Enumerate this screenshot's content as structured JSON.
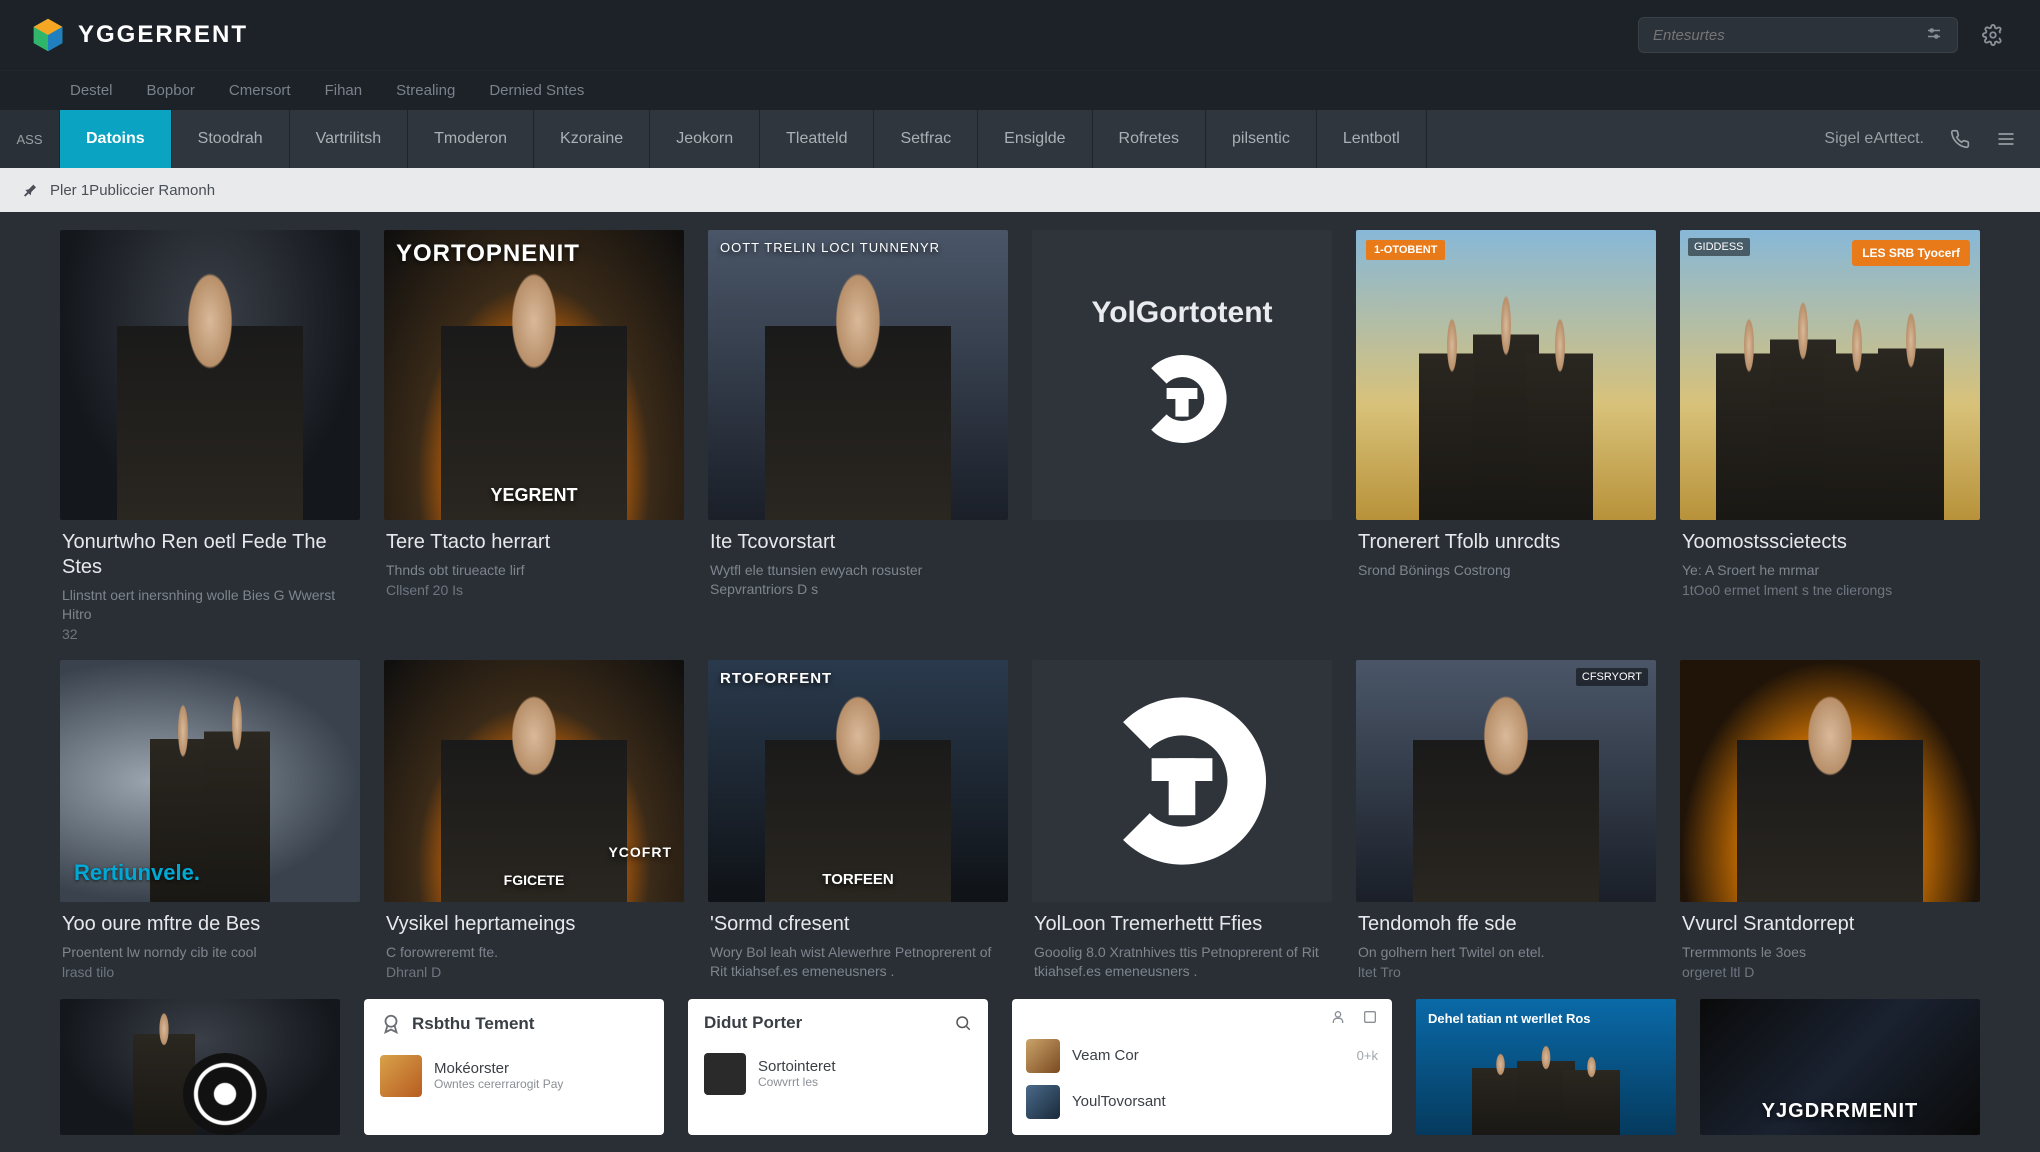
{
  "header": {
    "site_name": "YGGERRENT",
    "search_placeholder": "Entesurtes"
  },
  "subnav": [
    "Destel",
    "Bopbor",
    "Cmersort",
    "Fihan",
    "Strealing",
    "Dernied Sntes"
  ],
  "tabs": {
    "first": "ASS",
    "items": [
      "Datoins",
      "Stoodrah",
      "Vartrilitsh",
      "Tmoderon",
      "Kzoraine",
      "Jeokorn",
      "Tleatteld",
      "Setfrac",
      "Ensiglde",
      "Rofretes",
      "pilsentic",
      "Lentbotl"
    ],
    "active_index": 0,
    "right_label": "Sigel eArttect."
  },
  "breadcrumb": "Pler 1Publiccier Ramonh",
  "row1": [
    {
      "overlay": "",
      "title": "Yonurtwho Ren oetl Fede The Stes",
      "desc": "Llinstnt oert inersnhing wolle\nBies G Wwerst Hitro",
      "meta": "32",
      "poster_cls": "grad-dark",
      "person": true
    },
    {
      "overlay": "YORTOPNENIT",
      "brand_bottom": "YEGRENT",
      "title": "Tere Ttacto herrart",
      "desc": "Thnds obt tirueacte lirf",
      "meta": "Cllsenf  20 Is",
      "poster_cls": "grad-fire",
      "person": true
    },
    {
      "overlay": "OOTT TRELIN LOCI TUNNENYR",
      "title": "Ite Tcovorstart",
      "desc": "Wytfl ele ttunsien ewyach\nrosuster Sepvrantriors D s",
      "poster_cls": "grad-city",
      "person": true
    },
    {
      "hero": true,
      "hero_title": "YolGortotent"
    },
    {
      "orange_top_left": "1-OTOBENT",
      "title": "Tronerert Tfolb unrcdts",
      "desc": "Srond Bönings\nCostrong",
      "poster_cls": "grad-desert",
      "group": true
    },
    {
      "orange_badge": "LES SRB\nTyocerf",
      "corner": "GIDDESS",
      "title": "Yoomostsscietects",
      "desc": "Ye: A Sroert he mrmar",
      "meta": "1tOo0 ermet lment s tne clierongs",
      "poster_cls": "grad-desert",
      "group": true
    }
  ],
  "row2": [
    {
      "sub_over": "Rertiunvele.",
      "title": "Yoo oure mftre de Bes",
      "desc": "Proentent lw norndy cib ite cool",
      "meta": "lrasd tilo",
      "poster_cls": "grad-smoke",
      "two": true
    },
    {
      "overlay": "YCOFRT",
      "brand_bottom": "FGICETE",
      "title": "Vysikel heprtameings",
      "desc": "C forowreremt fte.",
      "meta": "Dhranl  D",
      "poster_cls": "grad-fire",
      "person": true
    },
    {
      "overlay": "RTOFORFENT",
      "brand_bottom": "TORFEEN",
      "title": "'Sormd cfresent",
      "desc": "Wory Bol leah wist Alewerhre\nPetnoprerent of Rit tkiahsef.es emeneusners .",
      "poster_cls": "grad-stormy",
      "person": true
    },
    {
      "hero_badge": true,
      "title": "YolLoon Tremerhettt Ffies",
      "desc": "Gooolig 8.0 Xratnhives ttis\nPetnoprerent of Rit tkiahsef.es emeneusners ."
    },
    {
      "corner": "CFSRYORT",
      "title": "Tendomoh ffe sde",
      "desc": "On golhern hert Twitel on etel.",
      "meta": "ltet Tro",
      "poster_cls": "grad-city",
      "person": true
    },
    {
      "title": "Vvurcl Srantdorrept",
      "desc": "Trermmonts le 3oes",
      "meta": "orgeret ltl D",
      "poster_cls": "grad-gold",
      "person": true
    }
  ],
  "row3": {
    "poster1_cls": "grad-dark",
    "panel1": {
      "title": "Rsbthu Tement",
      "item_title": "Mokéorster",
      "item_sub": "Owntes cererrarogit Pay"
    },
    "panel2": {
      "title": "Didut Porter",
      "item_title": "Sortointeret",
      "item_sub": "Cowvrrt les"
    },
    "chat": {
      "rows": [
        {
          "name": "Veam Cor",
          "meta": "0+k"
        },
        {
          "name": "YoulTovorsant",
          "meta": ""
        }
      ]
    },
    "blue_title": "Dehel tatian nt werllet Ros",
    "last_overlay": "YJGDRRMENIT"
  }
}
